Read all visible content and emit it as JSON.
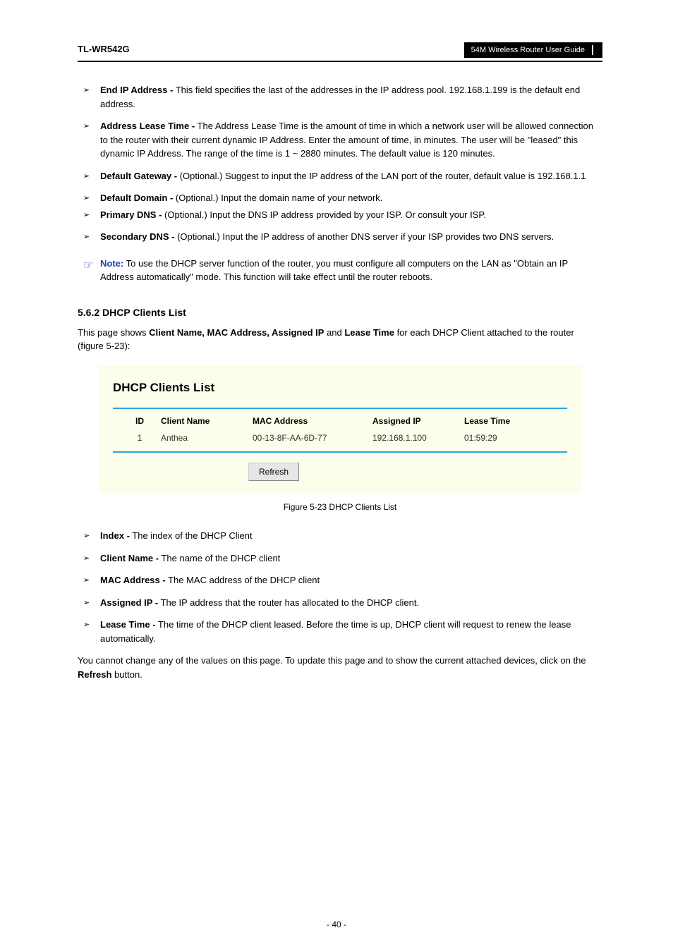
{
  "header": {
    "left": "TL-WR542G",
    "right": "54M Wireless Router User Guide"
  },
  "bullets1": [
    {
      "label": "End IP Address -",
      "text": " This field specifies the last of the addresses in the IP address pool. 192.168.1.199 is the default end address."
    },
    {
      "label": "Address Lease Time -",
      "text": " The Address Lease Time is the amount of time in which a network user will be allowed connection to the router with their current dynamic IP Address. Enter the amount of time, in minutes. The user will be \"leased\" this dynamic IP Address. The range of the time is 1 ~ 2880 minutes. The default value is 120 minutes."
    },
    {
      "label": "Default Gateway -",
      "text": " (Optional.) Suggest to input the IP address of the LAN port of the router, default value is 192.168.1.1"
    },
    {
      "label": "Default Domain -",
      "text": " (Optional.) Input the domain name of your network."
    },
    {
      "label": "Primary DNS -",
      "text": " (Optional.) Input the DNS IP address provided by your ISP. Or consult your ISP."
    },
    {
      "label": "Secondary DNS -",
      "text": " (Optional.) Input the IP address of another DNS server if your ISP provides two DNS servers."
    }
  ],
  "note": {
    "label": "Note:",
    "text": " To use the DHCP server function of the router, you must configure all computers on the LAN as \"Obtain an IP Address automatically\" mode. This function will take effect until the router reboots."
  },
  "section": {
    "title": "5.6.2 DHCP Clients List",
    "intro": "This page shows Client Name, MAC Address, Assigned IP and Lease Time for each DHCP Client attached to the router (figure 5-23):"
  },
  "figure": {
    "title": "DHCP Clients List",
    "headers": {
      "id": "ID",
      "name": "Client Name",
      "mac": "MAC Address",
      "ip": "Assigned IP",
      "lease": "Lease Time"
    },
    "rows": [
      {
        "id": "1",
        "name": "Anthea",
        "mac": "00-13-8F-AA-6D-77",
        "ip": "192.168.1.100",
        "lease": "01:59:29"
      }
    ],
    "refresh": "Refresh",
    "caption": "Figure 5-23 DHCP Clients List"
  },
  "bullets2": [
    {
      "label": "Index -",
      "text": " The index of the DHCP Client"
    },
    {
      "label": "Client Name -",
      "text": " The name of the DHCP client"
    },
    {
      "label": "MAC Address -",
      "text": " The MAC address of the DHCP client"
    },
    {
      "label": "Assigned IP -",
      "text": " The IP address that the router has allocated to the DHCP client."
    },
    {
      "label": "Lease Time -",
      "text": " The time of the DHCP client leased. Before the time is up, DHCP client will request to renew the lease automatically."
    }
  ],
  "closing": "You cannot change any of the values on this page. To update this page and to show the current attached devices, click on the Refresh button.",
  "pageNumber": "- 40 -"
}
